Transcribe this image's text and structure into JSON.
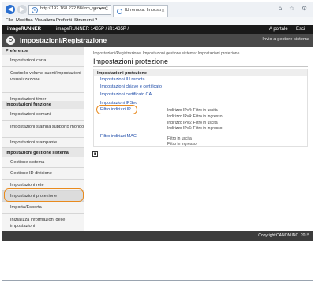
{
  "browser": {
    "url": "http://192.168.222.88/rrm_secure...",
    "tab_title": "IU remota: Impostazioni pr...",
    "url_tools": "ρ ▾ C",
    "tab_close": "×",
    "window_icons": "⌂ ☆ ⚙"
  },
  "menubar": {
    "items": [
      "File",
      "Modifica",
      "Visualizza",
      "Preferiti",
      "Strumenti",
      "?"
    ]
  },
  "device_bar": {
    "product": "imageRUNNER",
    "model": "imageRUNNER 1435P / iR1435P /",
    "portal": "A portale",
    "logout": "Esci"
  },
  "header": {
    "title": "Impostazioni/Registrazione",
    "manager_link": "Invio a gestore sistema"
  },
  "sidebar": {
    "sections": [
      {
        "label": "Preferenze"
      },
      {
        "label": "Impostazioni funzione"
      },
      {
        "label": "Impostazioni gestione sistema"
      }
    ],
    "items": [
      {
        "label": "Impostazioni carta"
      },
      {
        "label": "Controllo volume suoni/impostazioni visualizzazione"
      },
      {
        "label": "Impostazioni timer"
      },
      {
        "label": "Impostazioni comuni"
      },
      {
        "label": "Impostazioni stampa supporto mondo"
      },
      {
        "label": "Impostazioni stampante"
      },
      {
        "label": "Gestione sistema"
      },
      {
        "label": "Gestione ID divisione"
      },
      {
        "label": "Impostazioni rete"
      },
      {
        "label": "Impostazioni protezione"
      },
      {
        "label": "Importa/Esporta"
      },
      {
        "label": "Inizializza informazioni delle impostazioni"
      }
    ]
  },
  "main": {
    "breadcrumb": "Impostazioni/Registrazione: Impostazioni gestione sistema: Impostazioni protezione",
    "title": "Impostazioni protezione",
    "section_title": "Impostazioni protezione",
    "links": [
      "Impostazioni IU remota",
      "Impostazioni chiave e certificato",
      "Impostazioni certificato CA",
      "Impostazioni IPSec",
      "Filtro indirizzi IP",
      "Filtro indirizzi MAC"
    ],
    "ip_filter_notes": [
      "Indirizzo IPv4: Filtro in uscita",
      "Indirizzo IPv4: Filtro in ingresso",
      "Indirizzo IPv6: Filtro in uscita",
      "Indirizzo IPv6: Filtro in ingresso"
    ],
    "mac_filter_notes": [
      "Filtro in uscita",
      "Filtro in ingresso"
    ]
  },
  "footer": {
    "copyright": "Copyright CANON INC. 2015"
  },
  "colors": {
    "highlight": "#e88a1e",
    "link": "#1c4aa8",
    "header_bg": "#4a4a4a"
  }
}
